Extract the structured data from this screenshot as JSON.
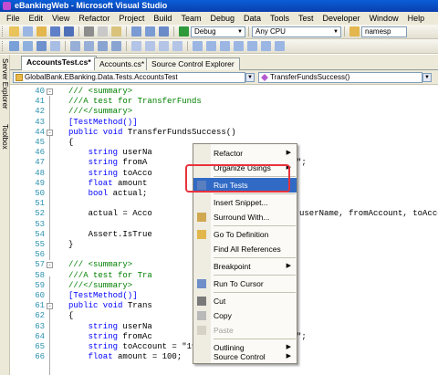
{
  "window": {
    "title": "eBankingWeb - Microsoft Visual Studio"
  },
  "menu": [
    "File",
    "Edit",
    "View",
    "Refactor",
    "Project",
    "Build",
    "Team",
    "Debug",
    "Data",
    "Tools",
    "Test",
    "Developer",
    "Window",
    "Help"
  ],
  "toolbar": {
    "config": "Debug",
    "platform": "Any CPU",
    "find": "namesp"
  },
  "sidebar": {
    "server_explorer": "Server Explorer",
    "toolbox": "Toolbox"
  },
  "tabs": [
    "AccountsTest.cs*",
    "Accounts.cs*",
    "Source Control Explorer"
  ],
  "navbar": {
    "class": "GlobalBank.EBanking.Data.Tests.AccountsTest",
    "member": "TransferFundsSuccess()"
  },
  "code_lines": [
    {
      "n": "40",
      "t": "/// <summary>"
    },
    {
      "n": "41",
      "t": "///A test for TransferFunds"
    },
    {
      "n": "42",
      "t": "///</summary>"
    },
    {
      "n": "43",
      "t": "[TestMethod()]"
    },
    {
      "n": "44",
      "t": "public void TransferFundsSuccess()"
    },
    {
      "n": "45",
      "t": "{"
    },
    {
      "n": "46",
      "t": "    string userNa"
    },
    {
      "n": "47",
      "t": "    string fromA"
    },
    {
      "n": "48",
      "t": "    string toAcco"
    },
    {
      "n": "49",
      "t": "    float amount"
    },
    {
      "n": "50",
      "t": "    bool actual;"
    },
    {
      "n": "51",
      "t": ""
    },
    {
      "n": "52",
      "t": "    actual = Acco"
    },
    {
      "n": "53",
      "t": ""
    },
    {
      "n": "54",
      "t": "    Assert.IsTrue"
    },
    {
      "n": "55",
      "t": "}"
    },
    {
      "n": "56",
      "t": ""
    },
    {
      "n": "57",
      "t": "/// <summary>"
    },
    {
      "n": "58",
      "t": "///A test for Tra"
    },
    {
      "n": "59",
      "t": "///</summary>"
    },
    {
      "n": "60",
      "t": "[TestMethod()]"
    },
    {
      "n": "61",
      "t": "public void Trans"
    },
    {
      "n": "62",
      "t": "{"
    },
    {
      "n": "63",
      "t": "    string userNa"
    },
    {
      "n": "64",
      "t": "    string fromAc"
    },
    {
      "n": "65",
      "t": "    string toAccount = \"1930-04190\";"
    },
    {
      "n": "66",
      "t": "    float amount = 100;"
    }
  ],
  "code_tails": {
    "line47": "\";",
    "line52": "userName, fromAccount, toAccoun",
    "line64": "\";"
  },
  "context_menu": {
    "items": [
      {
        "label": "Refactor",
        "submenu": true
      },
      {
        "label": "Organize Usings",
        "submenu": true
      },
      {
        "label": "Run Tests",
        "highlighted": true
      },
      {
        "label": "Insert Snippet..."
      },
      {
        "label": "Surround With..."
      },
      {
        "label": "Go To Definition"
      },
      {
        "label": "Find All References"
      },
      {
        "label": "Breakpoint",
        "submenu": true
      },
      {
        "label": "Run To Cursor"
      },
      {
        "label": "Cut"
      },
      {
        "label": "Copy"
      },
      {
        "label": "Paste",
        "disabled": true
      },
      {
        "label": "Outlining",
        "submenu": true
      },
      {
        "label": "Source Control",
        "submenu": true
      }
    ]
  },
  "colors": {
    "highlight": "#316ac5",
    "callout": "#e8323c",
    "keyword": "#0000ff",
    "comment": "#008000"
  }
}
